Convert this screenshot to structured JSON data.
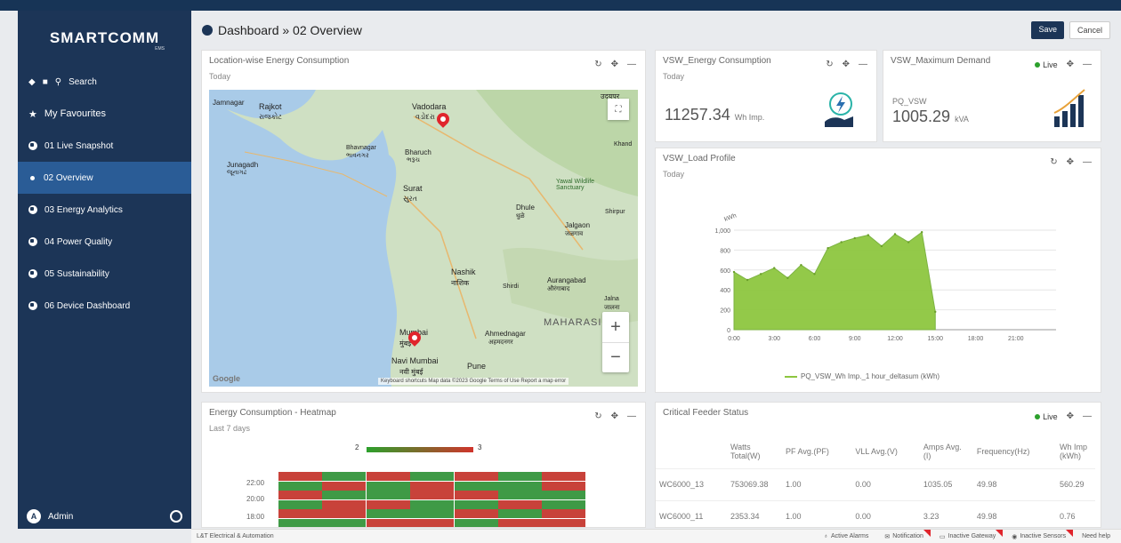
{
  "brand": {
    "name": "SMARTCOMM",
    "sub": "EMS"
  },
  "sidebar": {
    "search_label": "Search",
    "favourites_label": "My Favourites",
    "items": [
      {
        "label": "01 Live Snapshot"
      },
      {
        "label": "02 Overview"
      },
      {
        "label": "03 Energy Analytics"
      },
      {
        "label": "04 Power Quality"
      },
      {
        "label": "05 Sustainability"
      },
      {
        "label": "06 Device Dashboard"
      }
    ],
    "user": "Admin"
  },
  "header": {
    "breadcrumb": "Dashboard » 02 Overview",
    "save_label": "Save",
    "cancel_label": "Cancel"
  },
  "map_card": {
    "title": "Location-wise Energy Consumption",
    "subtitle": "Today",
    "labels": {
      "jamnagar": "Jamnagar",
      "rajkot": "Rajkot",
      "rajkot_local": "રાજકોટ",
      "vadodara": "Vadodara",
      "vadodara_local": "વડોદરા",
      "bhavnagar": "Bhavnagar",
      "bhavnagar_local": "ભાવનગર",
      "bharuch": "Bharuch",
      "bharuch_local": "ભરૂચ",
      "junagadh": "Junagadh",
      "junagadh_local": "જૂનાગઢ",
      "surat": "Surat",
      "surat_local": "સુરત",
      "dhule": "Dhule",
      "dhule_local": "धुळे",
      "jalgaon": "Jalgaon",
      "jalgaon_local": "जळगाव",
      "nashik": "Nashik",
      "nashik_local": "नाशिक",
      "aurangabad": "Aurangabad",
      "aurangabad_local": "औरंगाबाद",
      "jalna": "Jalna",
      "jalna_local": "जालना",
      "maharashtra": "MAHARASI",
      "ahmednagar": "Ahmednagar",
      "ahmednagar_local": "अहमदनगर",
      "mumbai": "Mumbai",
      "mumbai_local": "मुंबई",
      "navi_mumbai": "Navi Mumbai",
      "navi_mumbai_local": "नवी मुंबई",
      "pune": "Pune",
      "udaipur_local": "उदयपुर",
      "khandwa_local": "Khand",
      "sanctuary": "Yawal Wildlife Sanctuary",
      "shirpur": "Shirpur",
      "shrivardhan": "Shirdi",
      "google": "Google"
    },
    "footer": "Keyboard shortcuts  Map data ©2023 Google  Terms of Use  Report a map error"
  },
  "energy_card": {
    "title": "VSW_Energy Consumption",
    "subtitle": "Today",
    "value": "11257.34",
    "unit": "Wh Imp."
  },
  "demand_card": {
    "title": "VSW_Maximum Demand",
    "live": "Live",
    "device": "PQ_VSW",
    "value": "1005.29",
    "unit": "kVA"
  },
  "load_card": {
    "title": "VSW_Load Profile",
    "subtitle": "Today",
    "legend": "PQ_VSW_Wh Imp._1 hour_deltasum (kWh)"
  },
  "chart_data": {
    "type": "area",
    "ylabel": "kWh",
    "ylim": [
      0,
      1000
    ],
    "yticks": [
      "0",
      "200",
      "400",
      "600",
      "800",
      "1,000"
    ],
    "xticks": [
      "0:00",
      "3:00",
      "6:00",
      "9:00",
      "12:00",
      "15:00",
      "18:00",
      "21:00"
    ],
    "series": [
      {
        "name": "PQ_VSW_Wh Imp._1 hour_deltasum (kWh)",
        "x": [
          0,
          1,
          2,
          3,
          4,
          5,
          6,
          7,
          8,
          9,
          10,
          11,
          12,
          13,
          14,
          15
        ],
        "y": [
          580,
          500,
          560,
          620,
          520,
          650,
          560,
          820,
          880,
          920,
          950,
          840,
          960,
          880,
          980,
          180
        ]
      }
    ],
    "color": "#8dc63f"
  },
  "heatmap_card": {
    "title": "Energy Consumption - Heatmap",
    "subtitle": "Last 7 days",
    "scale_min": "2",
    "scale_max": "3",
    "y_labels": [
      "22:00",
      "20:00",
      "18:00"
    ]
  },
  "feeder_card": {
    "title": "Critical Feeder Status",
    "live": "Live",
    "columns": [
      "",
      "Watts Total(W)",
      "PF Avg.(PF)",
      "VLL Avg.(V)",
      "Amps Avg. (I)",
      "Frequency(Hz)",
      "Wh Imp (kWh)"
    ],
    "rows": [
      [
        "WC6000_13",
        "753069.38",
        "1.00",
        "0.00",
        "1035.05",
        "49.98",
        "560.29"
      ],
      [
        "WC6000_11",
        "2353.34",
        "1.00",
        "0.00",
        "3.23",
        "49.98",
        "0.76"
      ]
    ]
  },
  "status_bar": {
    "company": "L&T Electrical & Automation",
    "active_alarms": "Active Alarms",
    "notification": "Notification",
    "inactive_gateway": "Inactive Gateway",
    "inactive_sensors": "Inactive Sensors",
    "need_help": "Need help"
  }
}
